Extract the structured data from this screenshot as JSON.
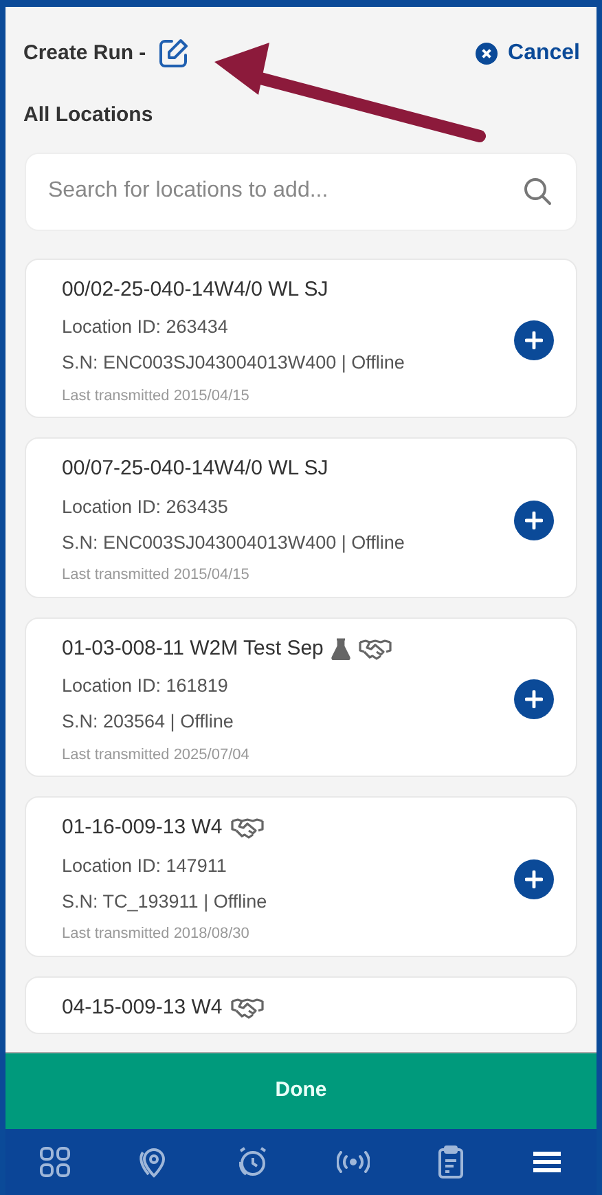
{
  "header": {
    "title": "Create Run -",
    "cancel": "Cancel"
  },
  "section_title": "All Locations",
  "search": {
    "placeholder": "Search for locations to add..."
  },
  "locations": [
    {
      "name": "00/02-25-040-14W4/0 WL SJ",
      "location_id": "Location ID: 263434",
      "serial": "S.N: ENC003SJ043004013W400 | Offline",
      "last_transmitted": "Last transmitted 2015/04/15"
    },
    {
      "name": "00/07-25-040-14W4/0 WL SJ",
      "location_id": "Location ID: 263435",
      "serial": "S.N: ENC003SJ043004013W400 | Offline",
      "last_transmitted": "Last transmitted 2015/04/15"
    },
    {
      "name": "01-03-008-11 W2M Test Sep",
      "badges": [
        {
          "kind": "flask"
        },
        {
          "kind": "handshake"
        }
      ],
      "location_id": "Location ID: 161819",
      "serial": "S.N: 203564 | Offline",
      "last_transmitted": "Last transmitted 2025/07/04"
    },
    {
      "name": "01-16-009-13 W4",
      "badges": [
        {
          "kind": "handshake"
        }
      ],
      "location_id": "Location ID: 147911",
      "serial": "S.N: TC_193911 | Offline",
      "last_transmitted": "Last transmitted 2018/08/30"
    },
    {
      "name": "04-15-009-13 W4",
      "badges": [
        {
          "kind": "handshake"
        }
      ]
    }
  ],
  "done_button": "Done",
  "bottom_nav": [
    {
      "kind": "grid"
    },
    {
      "kind": "location"
    },
    {
      "kind": "alarm"
    },
    {
      "kind": "signal"
    },
    {
      "kind": "clipboard"
    },
    {
      "kind": "menu"
    }
  ]
}
